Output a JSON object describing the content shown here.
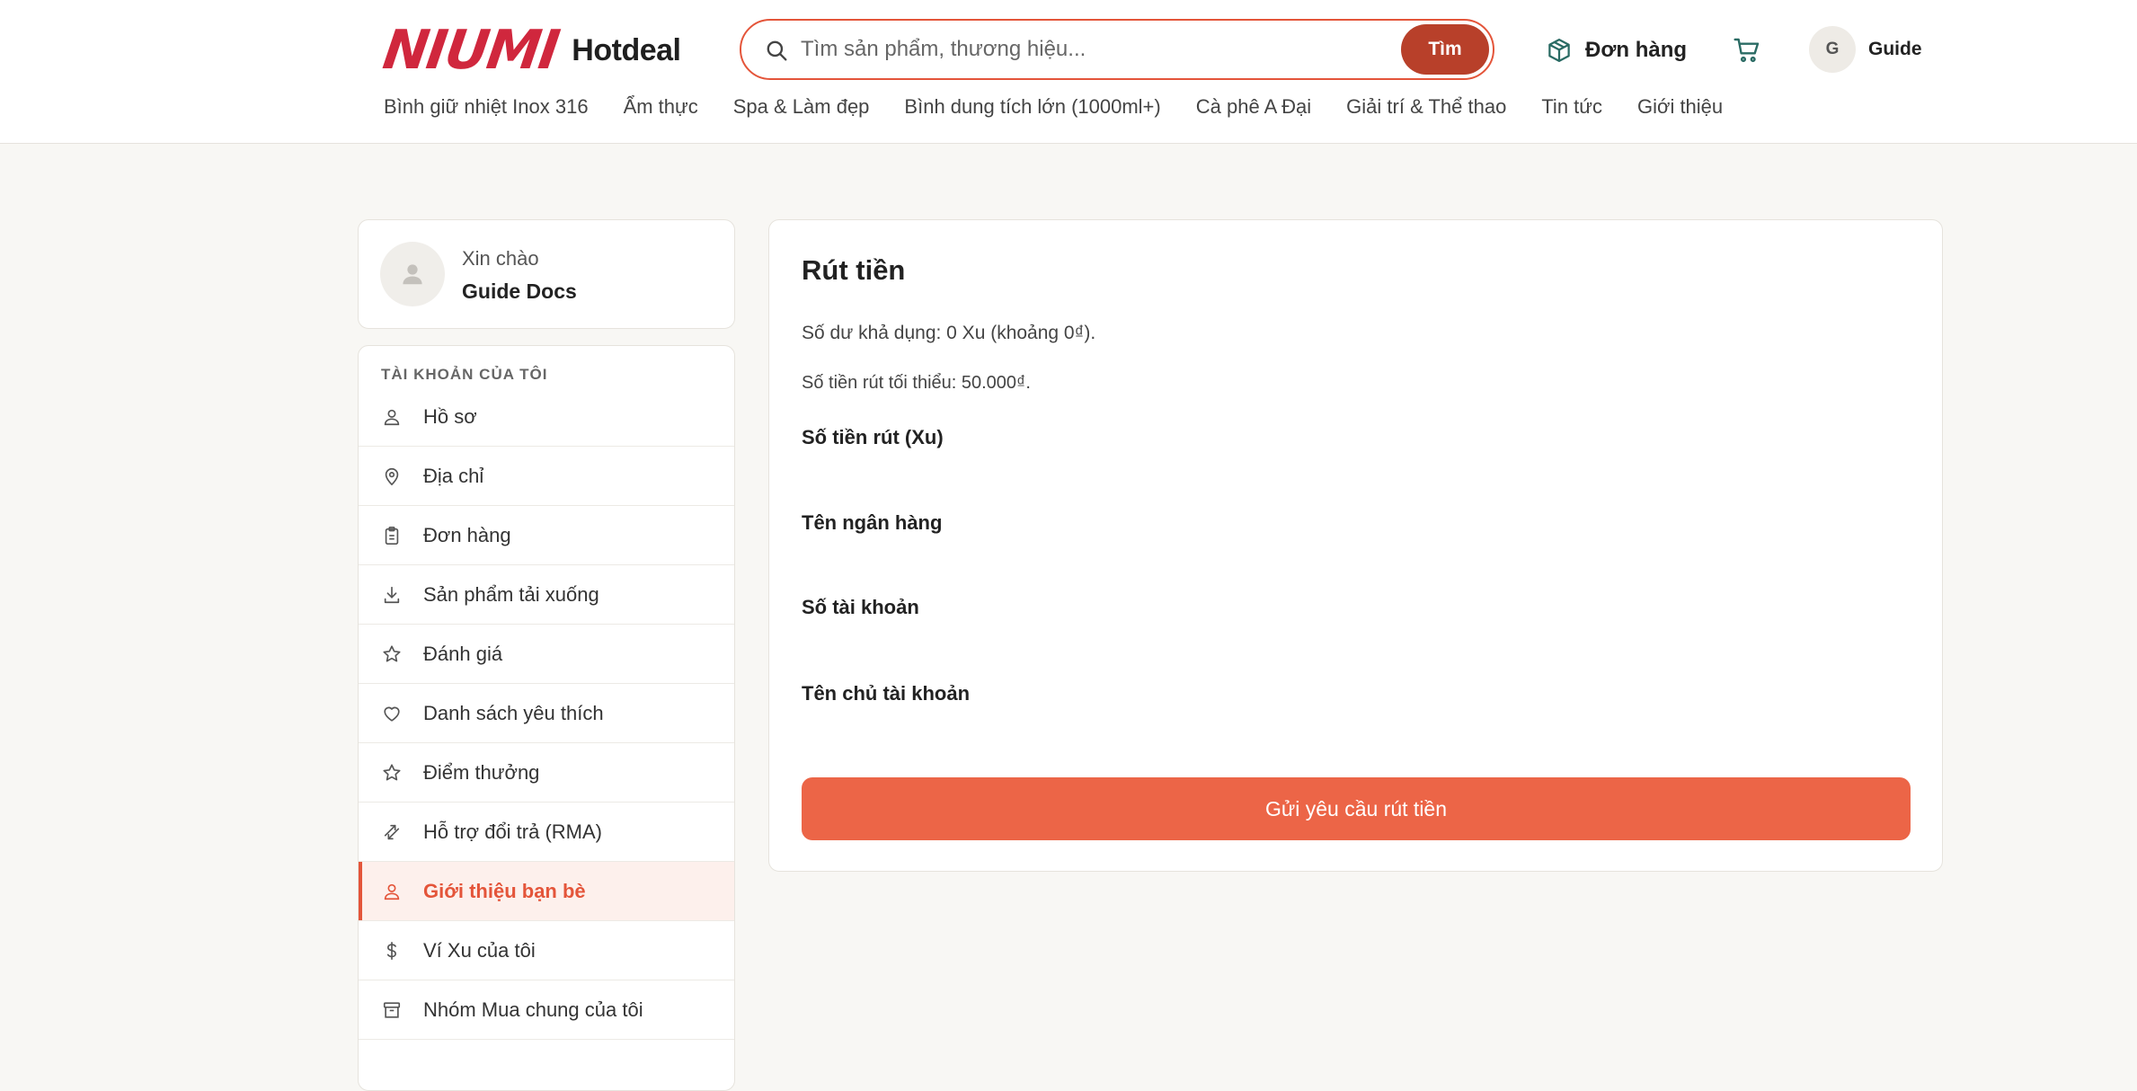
{
  "brand": {
    "logo_text": "NIUMI",
    "sub_text": "Hotdeal",
    "accent_color": "#d0273d"
  },
  "search": {
    "placeholder": "Tìm sản phẩm, thương hiệu...",
    "button_label": "Tìm",
    "icon": "search-icon"
  },
  "header": {
    "orders_label": "Đơn hàng",
    "orders_icon": "package-icon",
    "cart_icon": "cart-icon",
    "user_initial": "G",
    "user_name": "Guide"
  },
  "nav": {
    "items": [
      "Bình giữ nhiệt Inox 316",
      "Ẩm thực",
      "Spa & Làm đẹp",
      "Bình dung tích lớn (1000ml+)",
      "Cà phê A Đại",
      "Giải trí & Thể thao",
      "Tin tức",
      "Giới thiệu"
    ]
  },
  "greeting": {
    "hello": "Xin chào",
    "name": "Guide Docs"
  },
  "sidebar": {
    "title": "TÀI KHOẢN CỦA TÔI",
    "items": [
      {
        "label": "Hồ sơ",
        "icon": "user-icon"
      },
      {
        "label": "Địa chỉ",
        "icon": "map-pin-icon"
      },
      {
        "label": "Đơn hàng",
        "icon": "clipboard-icon"
      },
      {
        "label": "Sản phẩm tải xuống",
        "icon": "download-icon"
      },
      {
        "label": "Đánh giá",
        "icon": "star-icon"
      },
      {
        "label": "Danh sách yêu thích",
        "icon": "heart-icon"
      },
      {
        "label": "Điểm thưởng",
        "icon": "star-icon"
      },
      {
        "label": "Hỗ trợ đổi trả (RMA)",
        "icon": "exchange-icon"
      },
      {
        "label": "Giới thiệu bạn bè",
        "icon": "user-icon",
        "active": true
      },
      {
        "label": "Ví Xu của tôi",
        "icon": "dollar-icon"
      },
      {
        "label": "Nhóm Mua chung của tôi",
        "icon": "archive-icon"
      }
    ]
  },
  "withdraw": {
    "title": "Rút tiền",
    "balance_text": "Số dư khả dụng: 0 Xu (khoảng 0₫).",
    "minimum_text": "Số tiền rút tối thiểu: 50.000₫.",
    "fields": {
      "amount_label": "Số tiền rút (Xu)",
      "bank_label": "Tên ngân hàng",
      "account_number_label": "Số tài khoản",
      "account_holder_label": "Tên chủ tài khoản"
    },
    "submit_label": "Gửi yêu cầu rút tiền",
    "button_color": "#ec6547"
  }
}
